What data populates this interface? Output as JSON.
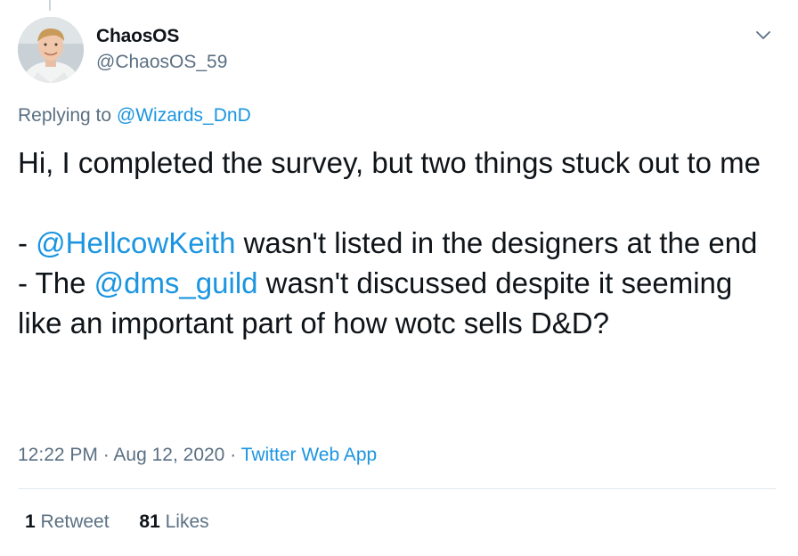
{
  "author": {
    "name": "ChaosOS",
    "handle": "@ChaosOS_59"
  },
  "reply": {
    "prefix": "Replying to ",
    "to": "@Wizards_DnD"
  },
  "tweet": {
    "line1": "Hi, I completed the survey, but two things stuck out to me",
    "bullet1_prefix": "- ",
    "bullet1_mention": "@HellcowKeith",
    "bullet1_suffix": " wasn't listed in the designers at the end",
    "bullet2_prefix": "- The ",
    "bullet2_mention": "@dms_guild",
    "bullet2_suffix": " wasn't discussed despite it seeming like an important part of how wotc sells D&D?"
  },
  "meta": {
    "time": "12:22 PM",
    "sep1": " · ",
    "date": "Aug 12, 2020",
    "sep2": " · ",
    "source": "Twitter Web App"
  },
  "stats": {
    "retweets_count": "1",
    "retweets_label": "Retweet",
    "likes_count": "81",
    "likes_label": "Likes"
  },
  "icons": {
    "caret": "chevron-down-icon"
  }
}
